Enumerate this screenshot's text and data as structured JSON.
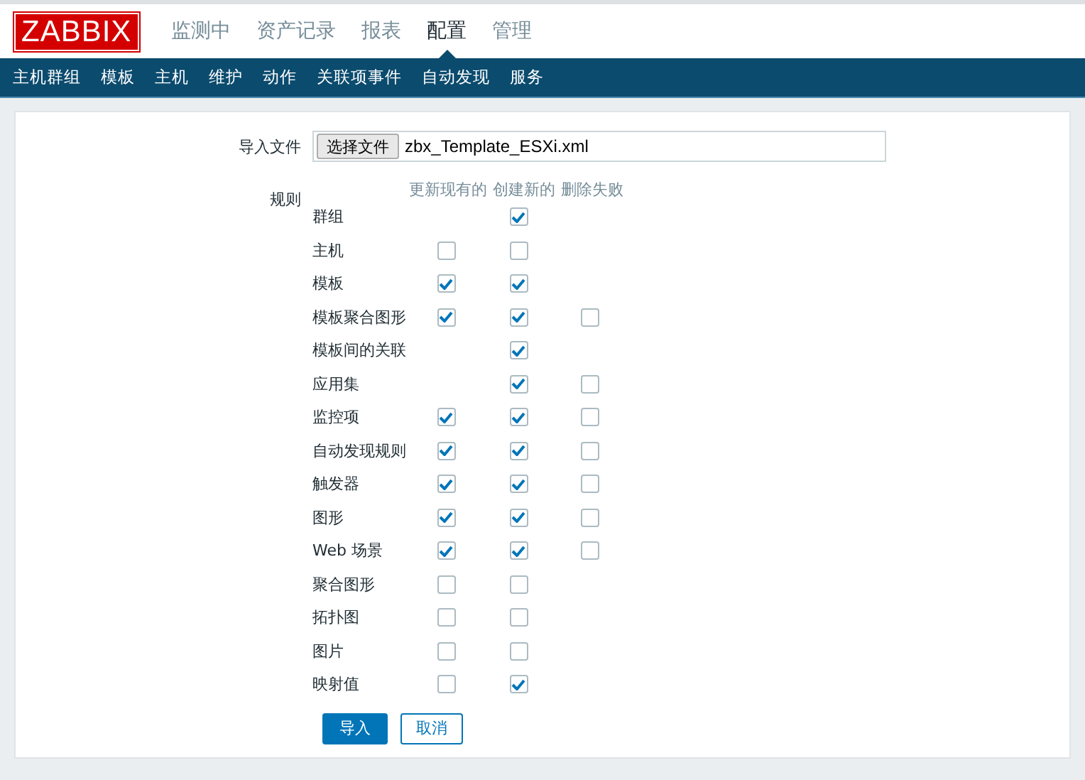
{
  "logo": "ZABBIX",
  "main_menu": [
    {
      "label": "监测中",
      "selected": false
    },
    {
      "label": "资产记录",
      "selected": false
    },
    {
      "label": "报表",
      "selected": false
    },
    {
      "label": "配置",
      "selected": true
    },
    {
      "label": "管理",
      "selected": false
    }
  ],
  "sub_menu": [
    "主机群组",
    "模板",
    "主机",
    "维护",
    "动作",
    "关联项事件",
    "自动发现",
    "服务"
  ],
  "form": {
    "file_label": "导入文件",
    "file_button": "选择文件",
    "file_name": "zbx_Template_ESXi.xml",
    "rules_label": "规则",
    "columns": [
      "更新现有的",
      "创建新的",
      "删除失败"
    ],
    "rules": [
      {
        "name": "群组",
        "create": {
          "checked": true
        }
      },
      {
        "name": "主机",
        "update": {
          "checked": false
        },
        "create": {
          "checked": false
        }
      },
      {
        "name": "模板",
        "update": {
          "checked": true
        },
        "create": {
          "checked": true
        }
      },
      {
        "name": "模板聚合图形",
        "update": {
          "checked": true
        },
        "create": {
          "checked": true
        },
        "delete": {
          "checked": false
        }
      },
      {
        "name": "模板间的关联",
        "create": {
          "checked": true
        }
      },
      {
        "name": "应用集",
        "create": {
          "checked": true
        },
        "delete": {
          "checked": false
        }
      },
      {
        "name": "监控项",
        "update": {
          "checked": true
        },
        "create": {
          "checked": true
        },
        "delete": {
          "checked": false
        }
      },
      {
        "name": "自动发现规则",
        "update": {
          "checked": true
        },
        "create": {
          "checked": true
        },
        "delete": {
          "checked": false
        }
      },
      {
        "name": "触发器",
        "update": {
          "checked": true
        },
        "create": {
          "checked": true
        },
        "delete": {
          "checked": false
        }
      },
      {
        "name": "图形",
        "update": {
          "checked": true
        },
        "create": {
          "checked": true
        },
        "delete": {
          "checked": false
        }
      },
      {
        "name": "Web 场景",
        "update": {
          "checked": true
        },
        "create": {
          "checked": true
        },
        "delete": {
          "checked": false
        }
      },
      {
        "name": "聚合图形",
        "update": {
          "checked": false
        },
        "create": {
          "checked": false
        }
      },
      {
        "name": "拓扑图",
        "update": {
          "checked": false
        },
        "create": {
          "checked": false
        }
      },
      {
        "name": "图片",
        "update": {
          "checked": false
        },
        "create": {
          "checked": false
        }
      },
      {
        "name": "映射值",
        "update": {
          "checked": false
        },
        "create": {
          "checked": true
        }
      }
    ],
    "import_button": "导入",
    "cancel_button": "取消"
  }
}
